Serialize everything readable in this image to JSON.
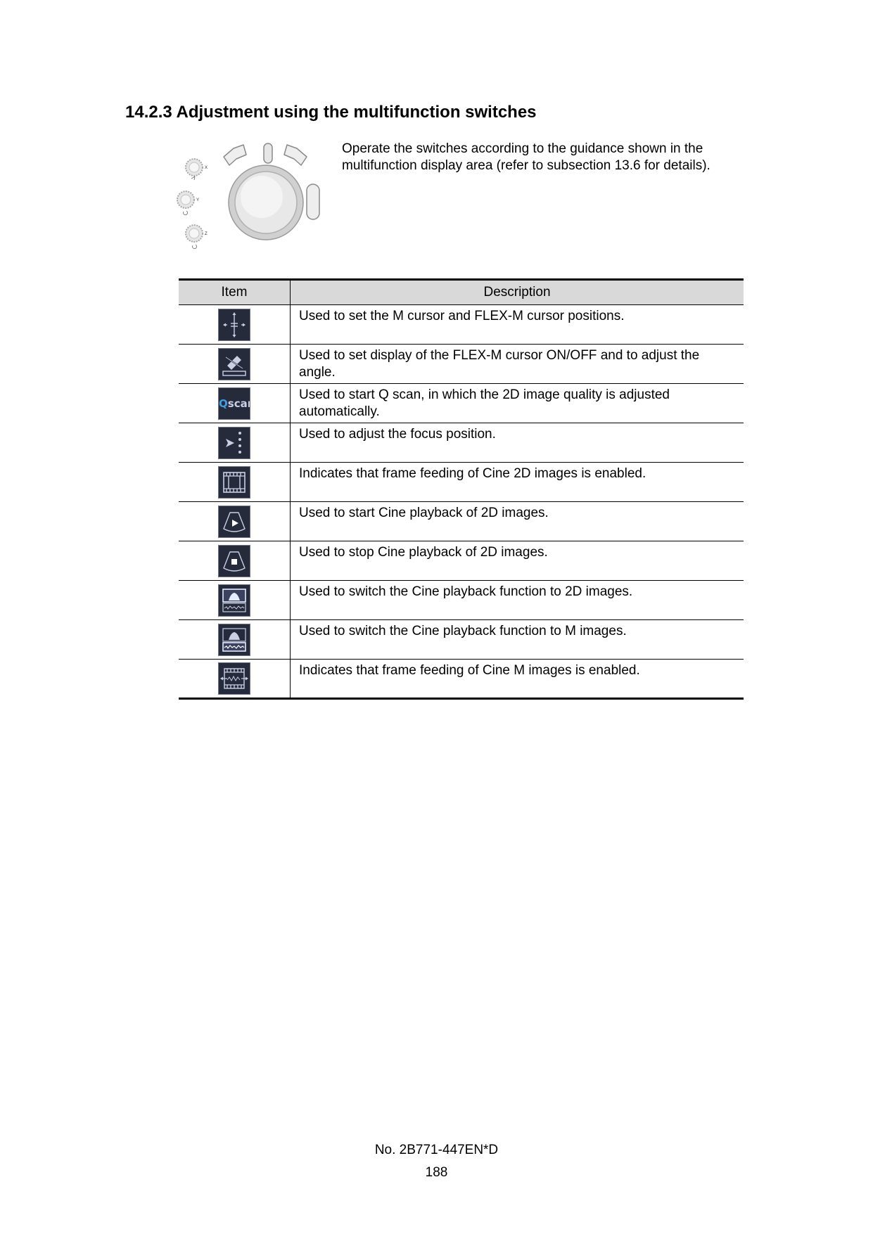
{
  "section": {
    "heading": "14.2.3 Adjustment using the multifunction switches"
  },
  "intro": {
    "text": "Operate the switches according to the guidance shown in the multifunction display area (refer to subsection 13.6 for details)."
  },
  "figure": {
    "knob_labels": [
      "X",
      "Y",
      "Z"
    ]
  },
  "table": {
    "headers": {
      "item": "Item",
      "description": "Description"
    },
    "rows": [
      {
        "icon": "m-cursor-position-icon",
        "description": "Used to set the M cursor and FLEX-M cursor positions."
      },
      {
        "icon": "flex-m-cursor-angle-icon",
        "description": "Used to set display of the FLEX-M cursor ON/OFF and to adjust the angle."
      },
      {
        "icon": "qscan-icon",
        "icon_text": "Qscan",
        "description": "Used to start Q scan, in which the 2D image quality is adjusted automatically."
      },
      {
        "icon": "focus-position-icon",
        "description": "Used to adjust the focus position."
      },
      {
        "icon": "cine-2d-frame-feed-icon",
        "description": "Indicates that frame feeding of Cine 2D images is enabled."
      },
      {
        "icon": "cine-2d-play-icon",
        "description": "Used to start Cine playback of 2D images."
      },
      {
        "icon": "cine-2d-stop-icon",
        "description": "Used to stop Cine playback of 2D images."
      },
      {
        "icon": "cine-switch-2d-icon",
        "description": "Used to switch the Cine playback function to 2D images."
      },
      {
        "icon": "cine-switch-m-icon",
        "description": "Used to switch the Cine playback function to M images."
      },
      {
        "icon": "cine-m-frame-feed-icon",
        "description": "Indicates that frame feeding of Cine M images is enabled."
      }
    ]
  },
  "footer": {
    "doc_number": "No. 2B771-447EN*D",
    "page_number": "188"
  },
  "colors": {
    "icon_background": "#262b3c",
    "icon_foreground": "#c9d0e6",
    "qscan_accent": "#3aa0e0",
    "table_header_background": "#d9d9d9"
  }
}
